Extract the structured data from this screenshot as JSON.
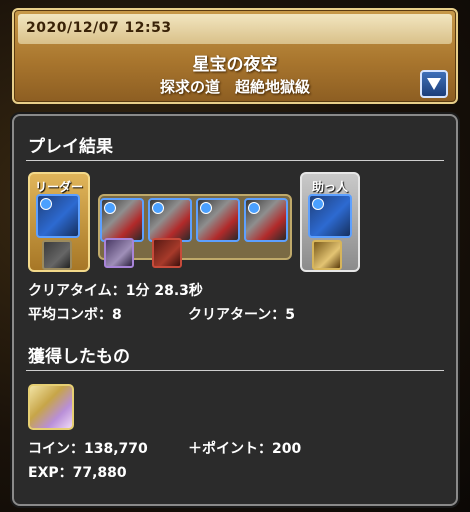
{
  "header": {
    "datetime": "2020/12/07 12:53",
    "dungeon_name": "星宝の夜空",
    "floor_name": "探求の道　超絶地獄級",
    "dropdown_icon": "triangle-down-icon"
  },
  "result": {
    "title": "プレイ結果",
    "leader_label": "リーダー",
    "helper_label": "助っ人",
    "clear_time": "クリアタイム：1分 28.3秒",
    "avg_combo": "平均コンボ：8",
    "clear_turn": "クリアターン：5"
  },
  "rewards": {
    "title": "獲得したもの",
    "coin": "コイン：138,770",
    "points": "＋ポイント：200",
    "exp": "EXP：77,880"
  },
  "colors": {
    "header_gold": "#a9762e",
    "panel_bg": "#2b2b2b",
    "leader_frame": "#e0b55a",
    "helper_frame": "#c9c9c9",
    "water_element": "#4aa0ff"
  }
}
